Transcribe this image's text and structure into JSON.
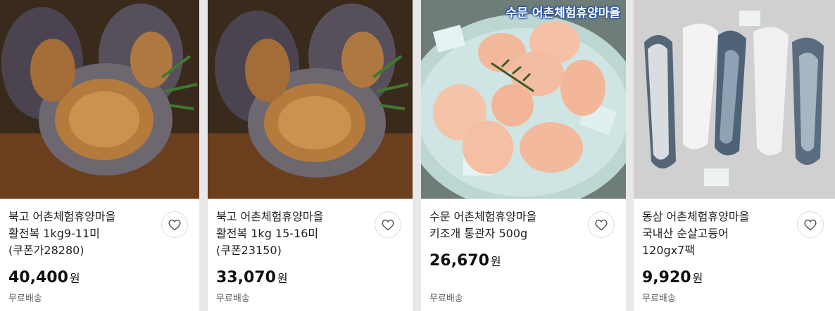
{
  "products": [
    {
      "title": "북고 어촌체험휴양마을 활전복 1kg9-11미(쿠폰가28280)",
      "price": "40,400",
      "currency": "원",
      "shipping": "무료배송",
      "image": "abalone"
    },
    {
      "title": "북고 어촌체험휴양마을 활전복 1kg 15-16미(쿠폰23150)",
      "price": "33,070",
      "currency": "원",
      "shipping": "무료배송",
      "image": "abalone"
    },
    {
      "title": "수문 어촌체험휴양마을 키조개 통관자 500g",
      "price": "26,670",
      "currency": "원",
      "shipping": "무료배송",
      "image": "scallop",
      "badge": "수문 어촌체험휴양마을"
    },
    {
      "title": "동삼 어촌체험휴양마을 국내산 순살고등어 120gx7팩",
      "price": "9,920",
      "currency": "원",
      "shipping": "무료배송",
      "image": "mackerel"
    }
  ],
  "icons": {
    "wishlist": "heart-outline-icon"
  },
  "colors": {
    "background": "#e8e8e8",
    "card": "#ffffff",
    "badge_outline": "#1f4fa0"
  }
}
